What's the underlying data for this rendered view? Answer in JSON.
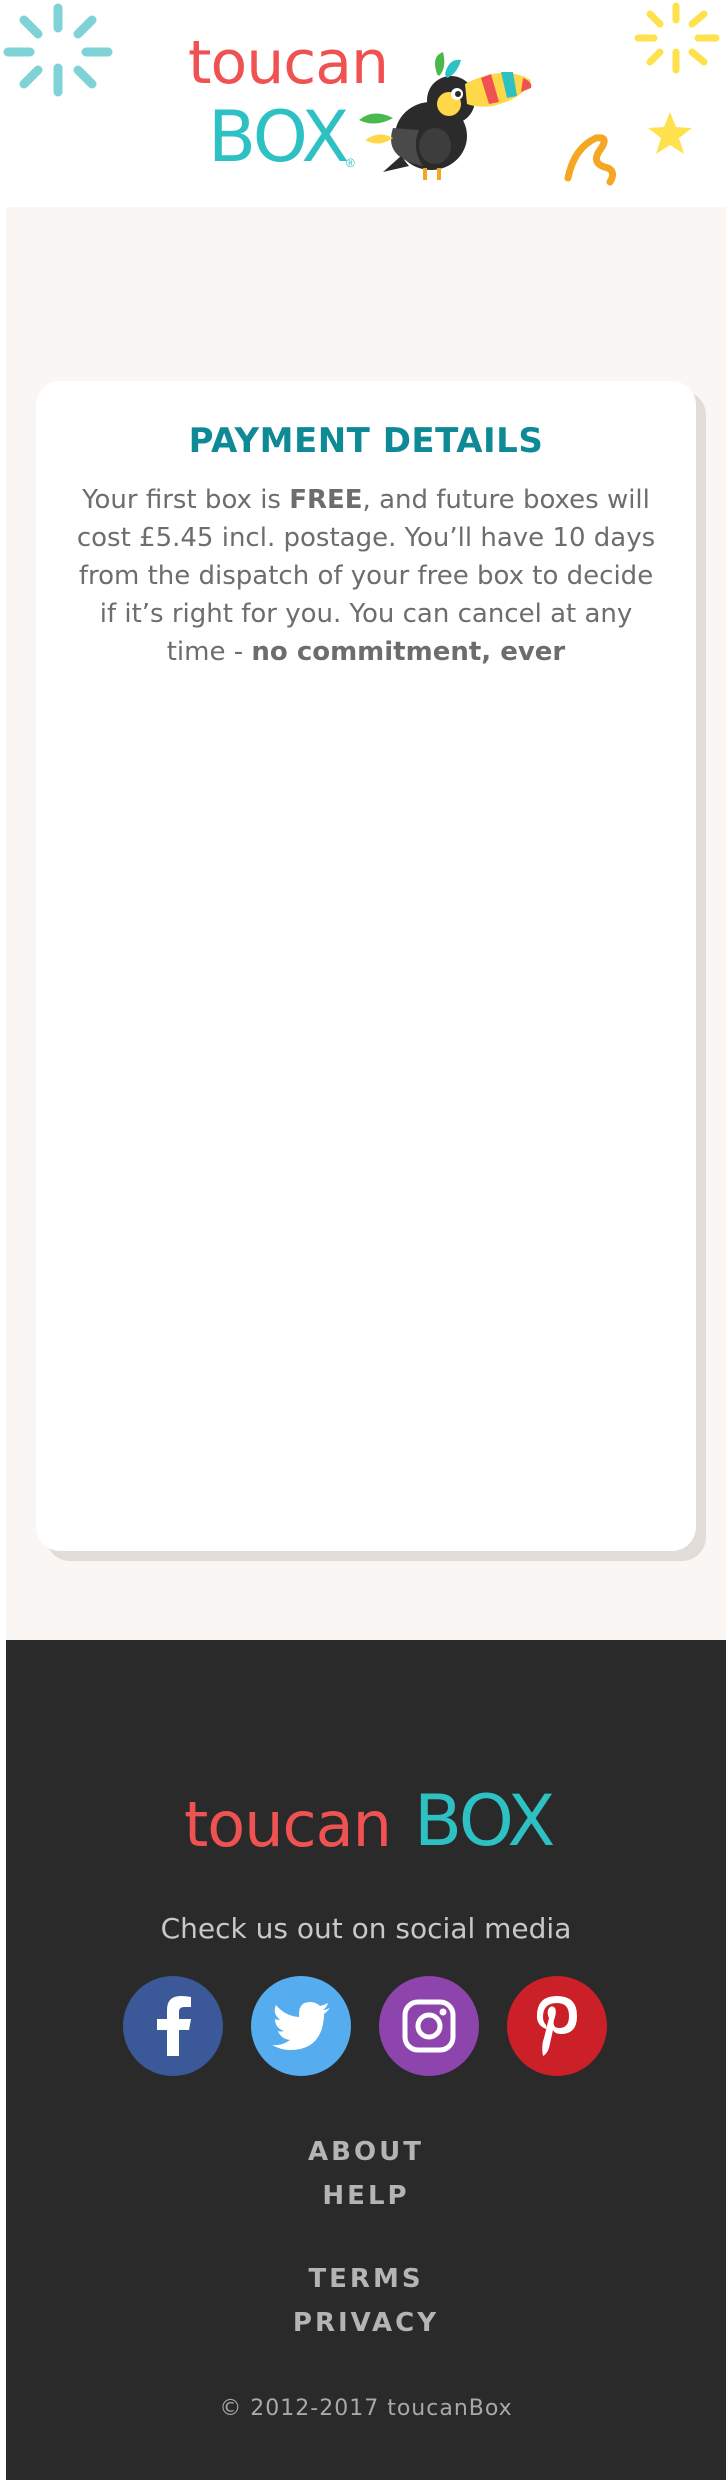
{
  "header": {
    "logo_word_top": "toucan",
    "logo_word_bottom": "BOX",
    "logo_reg": "®"
  },
  "card": {
    "title": "PAYMENT DETAILS",
    "text_1": "Your first box is ",
    "text_bold_1": "FREE",
    "text_2": ", and future boxes will cost £5.45 incl. postage. You’ll have 10 days from the dispatch of your free box to decide if it’s right for you. You can cancel at any time - ",
    "text_bold_2": "no commitment, ever"
  },
  "footer": {
    "logo_word_1": "toucan",
    "logo_word_2": "BOX",
    "social_label": "Check us out on social media",
    "social": [
      {
        "icon": "facebook-icon",
        "color": "#3b5998"
      },
      {
        "icon": "twitter-icon",
        "color": "#55acee"
      },
      {
        "icon": "instagram-icon",
        "color": "#8e44ad"
      },
      {
        "icon": "pinterest-icon",
        "color": "#cb2027"
      }
    ],
    "links": {
      "about": "ABOUT",
      "help": "HELP",
      "terms": "TERMS",
      "privacy": "PRIVACY"
    },
    "copyright": "© 2012-2017 toucanBox"
  },
  "colors": {
    "brand_red": "#f05252",
    "brand_teal": "#2ec1c3",
    "title_teal": "#0e8a97",
    "footer_bg": "#2a2a2a",
    "main_bg": "#f9f6f4"
  }
}
